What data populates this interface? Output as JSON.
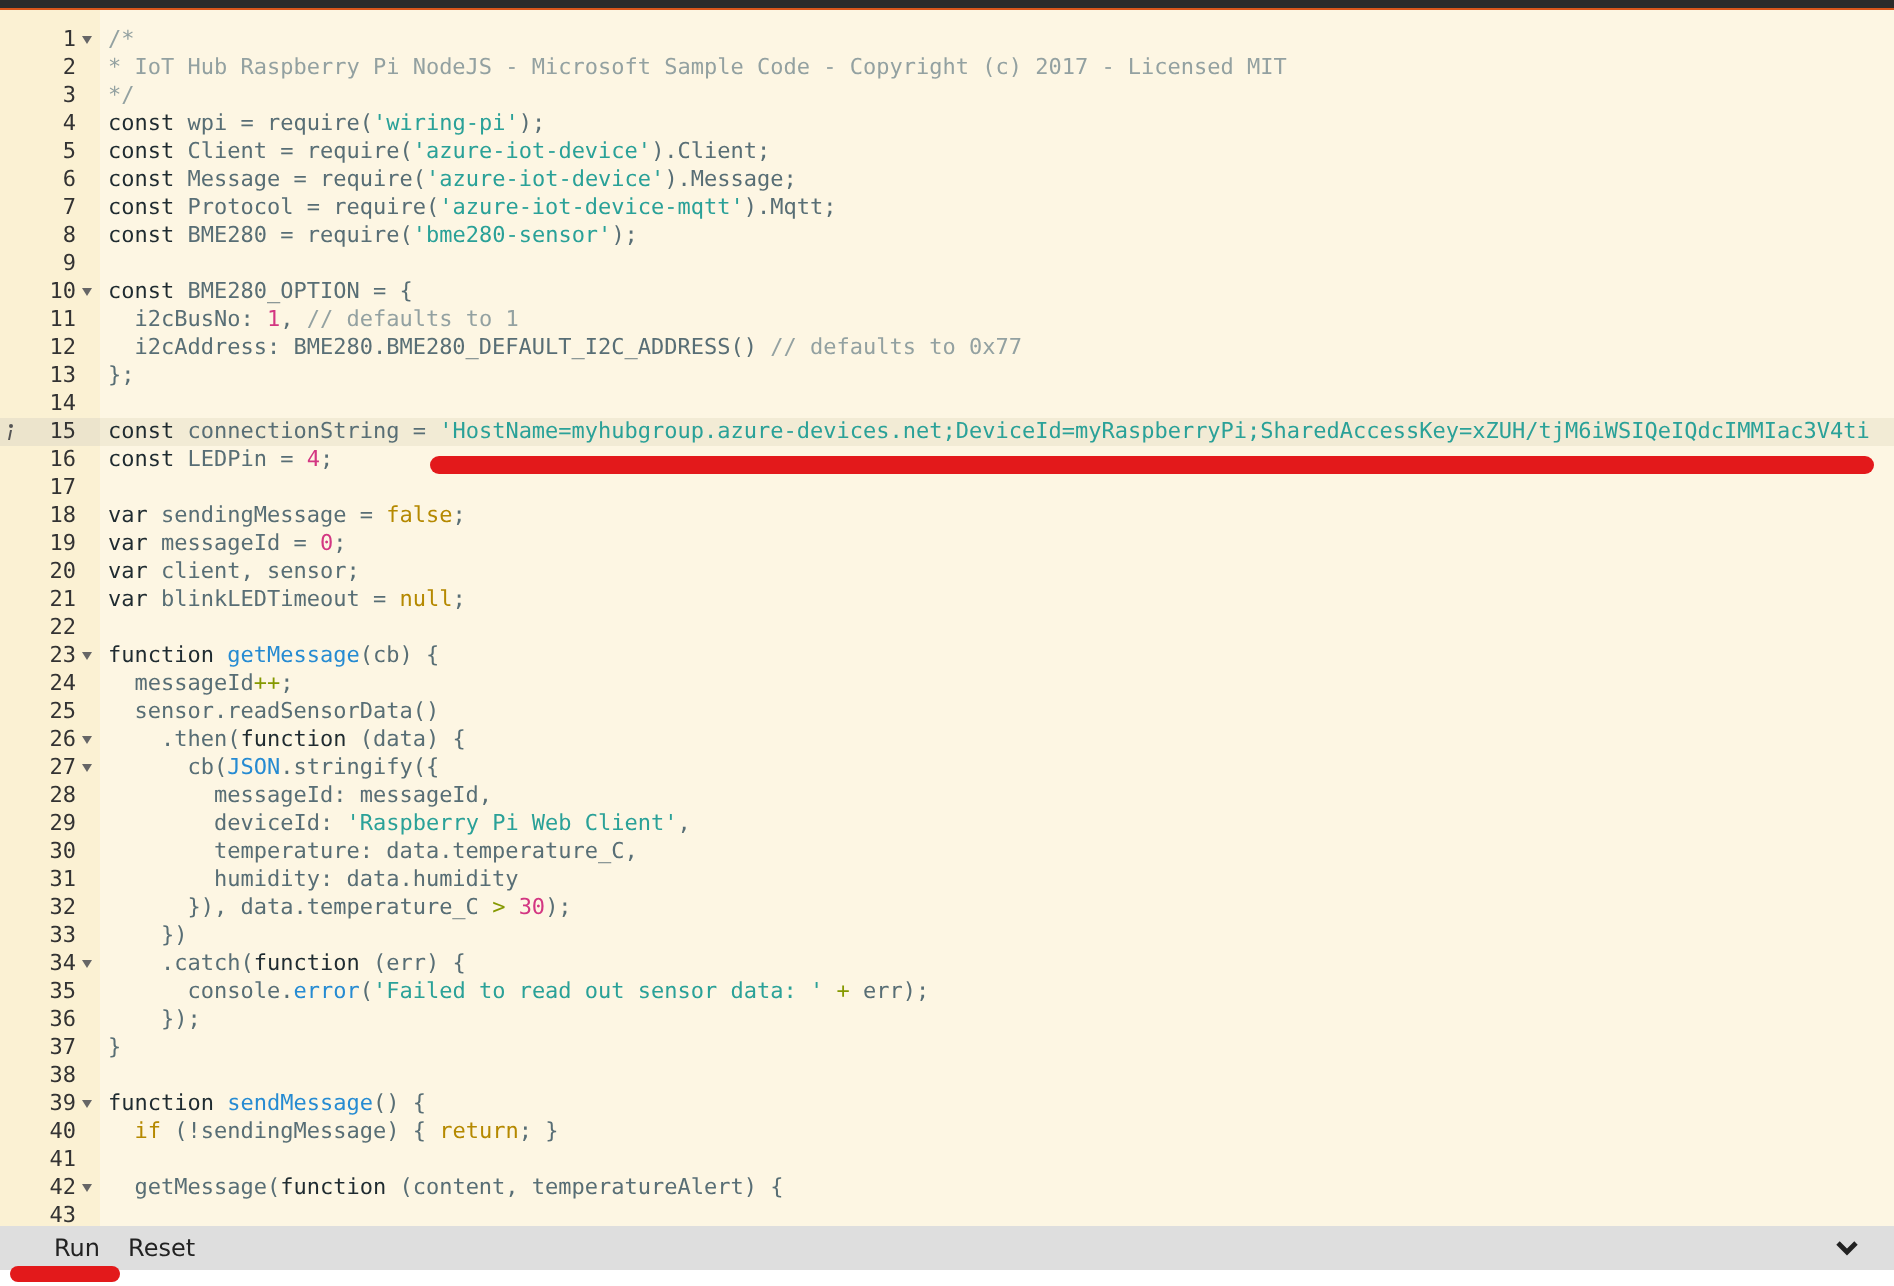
{
  "editor": {
    "lines": [
      {
        "number": "1",
        "foldable": true,
        "tokens": [
          {
            "kind": "comment",
            "text": "/*"
          }
        ]
      },
      {
        "number": "2",
        "foldable": false,
        "tokens": [
          {
            "kind": "comment",
            "text": "* IoT Hub Raspberry Pi NodeJS - Microsoft Sample Code - Copyright (c) 2017 - Licensed MIT"
          }
        ]
      },
      {
        "number": "3",
        "foldable": false,
        "tokens": [
          {
            "kind": "comment",
            "text": "*/"
          }
        ]
      },
      {
        "number": "4",
        "foldable": false,
        "tokens": [
          {
            "kind": "keyword",
            "text": "const"
          },
          {
            "kind": "plain",
            "text": " wpi = require("
          },
          {
            "kind": "string",
            "text": "'wiring-pi'"
          },
          {
            "kind": "plain",
            "text": ");"
          }
        ]
      },
      {
        "number": "5",
        "foldable": false,
        "tokens": [
          {
            "kind": "keyword",
            "text": "const"
          },
          {
            "kind": "plain",
            "text": " Client = require("
          },
          {
            "kind": "string",
            "text": "'azure-iot-device'"
          },
          {
            "kind": "plain",
            "text": ").Client;"
          }
        ]
      },
      {
        "number": "6",
        "foldable": false,
        "tokens": [
          {
            "kind": "keyword",
            "text": "const"
          },
          {
            "kind": "plain",
            "text": " Message = require("
          },
          {
            "kind": "string",
            "text": "'azure-iot-device'"
          },
          {
            "kind": "plain",
            "text": ").Message;"
          }
        ]
      },
      {
        "number": "7",
        "foldable": false,
        "tokens": [
          {
            "kind": "keyword",
            "text": "const"
          },
          {
            "kind": "plain",
            "text": " Protocol = require("
          },
          {
            "kind": "string",
            "text": "'azure-iot-device-mqtt'"
          },
          {
            "kind": "plain",
            "text": ").Mqtt;"
          }
        ]
      },
      {
        "number": "8",
        "foldable": false,
        "tokens": [
          {
            "kind": "keyword",
            "text": "const"
          },
          {
            "kind": "plain",
            "text": " BME280 = require("
          },
          {
            "kind": "string",
            "text": "'bme280-sensor'"
          },
          {
            "kind": "plain",
            "text": ");"
          }
        ]
      },
      {
        "number": "9",
        "foldable": false
      },
      {
        "number": "10",
        "foldable": true,
        "tokens": [
          {
            "kind": "keyword",
            "text": "const"
          },
          {
            "kind": "plain",
            "text": " BME280_OPTION = {"
          }
        ]
      },
      {
        "number": "11",
        "foldable": false,
        "tokens": [
          {
            "kind": "plain",
            "text": "  i2cBusNo: "
          },
          {
            "kind": "number",
            "text": "1"
          },
          {
            "kind": "plain",
            "text": ", "
          },
          {
            "kind": "comment",
            "text": "// defaults to 1"
          }
        ]
      },
      {
        "number": "12",
        "foldable": false,
        "tokens": [
          {
            "kind": "plain",
            "text": "  i2cAddress: BME280.BME280_DEFAULT_I2C_ADDRESS() "
          },
          {
            "kind": "comment",
            "text": "// defaults to 0x77"
          }
        ]
      },
      {
        "number": "13",
        "foldable": false,
        "tokens": [
          {
            "kind": "plain",
            "text": "};"
          }
        ]
      },
      {
        "number": "14",
        "foldable": false
      },
      {
        "number": "15",
        "foldable": false,
        "active": true,
        "info": true,
        "tokens": [
          {
            "kind": "keyword",
            "text": "const"
          },
          {
            "kind": "plain",
            "text": " connectionString = "
          },
          {
            "kind": "string",
            "text": "'HostName=myhubgroup.azure-devices.net;DeviceId=myRaspberryPi;SharedAccessKey=xZUH/tjM6iWSIQeIQdcIMMIac3V4ti"
          }
        ]
      },
      {
        "number": "16",
        "foldable": false,
        "underlined": true,
        "tokens": [
          {
            "kind": "keyword",
            "text": "const"
          },
          {
            "kind": "plain",
            "text": " LEDPin = "
          },
          {
            "kind": "number",
            "text": "4"
          },
          {
            "kind": "plain",
            "text": ";"
          }
        ]
      },
      {
        "number": "17",
        "foldable": false
      },
      {
        "number": "18",
        "foldable": false,
        "tokens": [
          {
            "kind": "keyword",
            "text": "var"
          },
          {
            "kind": "plain",
            "text": " sendingMessage = "
          },
          {
            "kind": "literal",
            "text": "false"
          },
          {
            "kind": "plain",
            "text": ";"
          }
        ]
      },
      {
        "number": "19",
        "foldable": false,
        "tokens": [
          {
            "kind": "keyword",
            "text": "var"
          },
          {
            "kind": "plain",
            "text": " messageId = "
          },
          {
            "kind": "number",
            "text": "0"
          },
          {
            "kind": "plain",
            "text": ";"
          }
        ]
      },
      {
        "number": "20",
        "foldable": false,
        "tokens": [
          {
            "kind": "keyword",
            "text": "var"
          },
          {
            "kind": "plain",
            "text": " client, sensor;"
          }
        ]
      },
      {
        "number": "21",
        "foldable": false,
        "tokens": [
          {
            "kind": "keyword",
            "text": "var"
          },
          {
            "kind": "plain",
            "text": " blinkLEDTimeout = "
          },
          {
            "kind": "literal",
            "text": "null"
          },
          {
            "kind": "plain",
            "text": ";"
          }
        ]
      },
      {
        "number": "22",
        "foldable": false
      },
      {
        "number": "23",
        "foldable": true,
        "tokens": [
          {
            "kind": "keyword",
            "text": "function"
          },
          {
            "kind": "function",
            "text": " getMessage"
          },
          {
            "kind": "plain",
            "text": "(cb) {"
          }
        ]
      },
      {
        "number": "24",
        "foldable": false,
        "tokens": [
          {
            "kind": "plain",
            "text": "  messageId"
          },
          {
            "kind": "operator",
            "text": "++"
          },
          {
            "kind": "plain",
            "text": ";"
          }
        ]
      },
      {
        "number": "25",
        "foldable": false,
        "tokens": [
          {
            "kind": "plain",
            "text": "  sensor.readSensorData()"
          }
        ]
      },
      {
        "number": "26",
        "foldable": true,
        "tokens": [
          {
            "kind": "plain",
            "text": "    .then("
          },
          {
            "kind": "keyword",
            "text": "function"
          },
          {
            "kind": "plain",
            "text": " (data) {"
          }
        ]
      },
      {
        "number": "27",
        "foldable": true,
        "tokens": [
          {
            "kind": "plain",
            "text": "      cb("
          },
          {
            "kind": "function",
            "text": "JSON"
          },
          {
            "kind": "plain",
            "text": ".stringify({"
          }
        ]
      },
      {
        "number": "28",
        "foldable": false,
        "tokens": [
          {
            "kind": "plain",
            "text": "        messageId: messageId,"
          }
        ]
      },
      {
        "number": "29",
        "foldable": false,
        "tokens": [
          {
            "kind": "plain",
            "text": "        deviceId: "
          },
          {
            "kind": "string",
            "text": "'Raspberry Pi Web Client'"
          },
          {
            "kind": "plain",
            "text": ","
          }
        ]
      },
      {
        "number": "30",
        "foldable": false,
        "tokens": [
          {
            "kind": "plain",
            "text": "        temperature: data.temperature_C,"
          }
        ]
      },
      {
        "number": "31",
        "foldable": false,
        "tokens": [
          {
            "kind": "plain",
            "text": "        humidity: data.humidity"
          }
        ]
      },
      {
        "number": "32",
        "foldable": false,
        "tokens": [
          {
            "kind": "plain",
            "text": "      }), data.temperature_C "
          },
          {
            "kind": "operator",
            "text": "> "
          },
          {
            "kind": "number",
            "text": "30"
          },
          {
            "kind": "plain",
            "text": ");"
          }
        ]
      },
      {
        "number": "33",
        "foldable": false,
        "tokens": [
          {
            "kind": "plain",
            "text": "    })"
          }
        ]
      },
      {
        "number": "34",
        "foldable": true,
        "tokens": [
          {
            "kind": "plain",
            "text": "    .catch("
          },
          {
            "kind": "keyword",
            "text": "function"
          },
          {
            "kind": "plain",
            "text": " (err) {"
          }
        ]
      },
      {
        "number": "35",
        "foldable": false,
        "tokens": [
          {
            "kind": "plain",
            "text": "      console."
          },
          {
            "kind": "function",
            "text": "error"
          },
          {
            "kind": "plain",
            "text": "("
          },
          {
            "kind": "string",
            "text": "'Failed to read out sensor data: '"
          },
          {
            "kind": "operator",
            "text": " +"
          },
          {
            "kind": "plain",
            "text": " err);"
          }
        ]
      },
      {
        "number": "36",
        "foldable": false,
        "tokens": [
          {
            "kind": "plain",
            "text": "    });"
          }
        ]
      },
      {
        "number": "37",
        "foldable": false,
        "tokens": [
          {
            "kind": "plain",
            "text": "}"
          }
        ]
      },
      {
        "number": "38",
        "foldable": false
      },
      {
        "number": "39",
        "foldable": true,
        "tokens": [
          {
            "kind": "keyword",
            "text": "function"
          },
          {
            "kind": "function",
            "text": " sendMessage"
          },
          {
            "kind": "plain",
            "text": "() {"
          }
        ]
      },
      {
        "number": "40",
        "foldable": false,
        "tokens": [
          {
            "kind": "literal",
            "text": "  if"
          },
          {
            "kind": "plain",
            "text": " (!sendingMessage) { "
          },
          {
            "kind": "literal",
            "text": "return"
          },
          {
            "kind": "plain",
            "text": "; }"
          }
        ]
      },
      {
        "number": "41",
        "foldable": false
      },
      {
        "number": "42",
        "foldable": true,
        "tokens": [
          {
            "kind": "plain",
            "text": "  getMessage("
          },
          {
            "kind": "keyword",
            "text": "function"
          },
          {
            "kind": "plain",
            "text": " (content, temperatureAlert) {"
          }
        ]
      },
      {
        "number": "43",
        "foldable": false
      }
    ]
  },
  "toolbar": {
    "buttons": [
      {
        "label": "Run",
        "underlined": true
      },
      {
        "label": "Reset",
        "underlined": false
      }
    ]
  }
}
